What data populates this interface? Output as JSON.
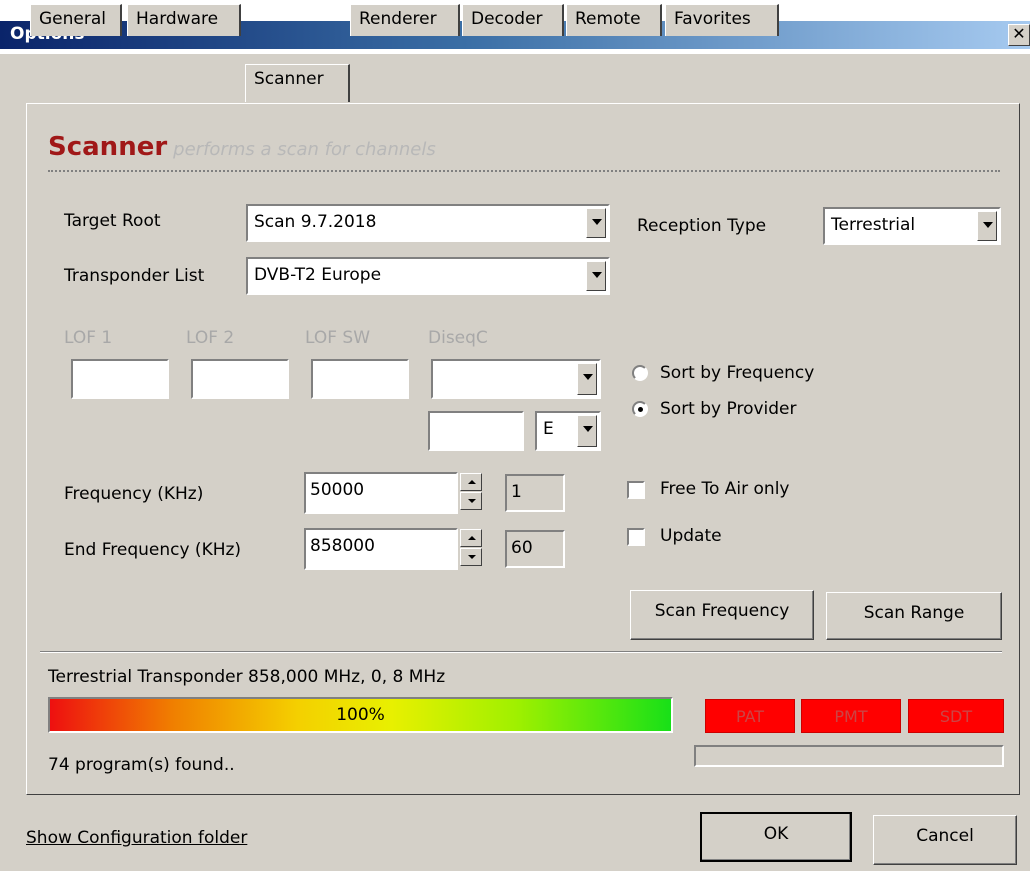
{
  "window": {
    "title": "Options",
    "close_glyph": "✕"
  },
  "tabs": [
    "General",
    "Hardware",
    "Scanner",
    "Renderer",
    "Decoder",
    "Remote",
    "Favorites"
  ],
  "header": {
    "title": "Scanner",
    "subtitle": "performs a scan for channels"
  },
  "target_root": {
    "label": "Target Root",
    "value": "Scan 9.7.2018"
  },
  "reception_type": {
    "label": "Reception Type",
    "value": "Terrestrial"
  },
  "transponder_list": {
    "label": "Transponder List",
    "value": "DVB-T2 Europe"
  },
  "lnb": {
    "lof1_label": "LOF 1",
    "lof2_label": "LOF 2",
    "lofsw_label": "LOF SW",
    "diseqc_label": "DiseqC",
    "lof1": "",
    "lof2": "",
    "lofsw": "",
    "diseqc": "",
    "pos": "",
    "dir": "E"
  },
  "sort": {
    "by_frequency": "Sort by Frequency",
    "by_provider": "Sort by Provider",
    "selected": "provider"
  },
  "frequency": {
    "label": "Frequency (KHz)",
    "value": "50000",
    "channel": "1"
  },
  "end_frequency": {
    "label": "End  Frequency (KHz)",
    "value": "858000",
    "channel": "60"
  },
  "options": {
    "free_to_air": "Free To Air only",
    "update": "Update"
  },
  "buttons": {
    "scan_frequency": "Scan Frequency",
    "scan_range": "Scan Range",
    "ok": "OK",
    "cancel": "Cancel"
  },
  "status": {
    "transponder": "Terrestrial Transponder 858,000 MHz, 0, 8 MHz",
    "progress_label": "100%",
    "progress": 1.0,
    "found": "74 program(s) found.."
  },
  "tables": [
    "PAT",
    "PMT",
    "SDT"
  ],
  "footer": {
    "config_link": "Show Configuration folder"
  }
}
